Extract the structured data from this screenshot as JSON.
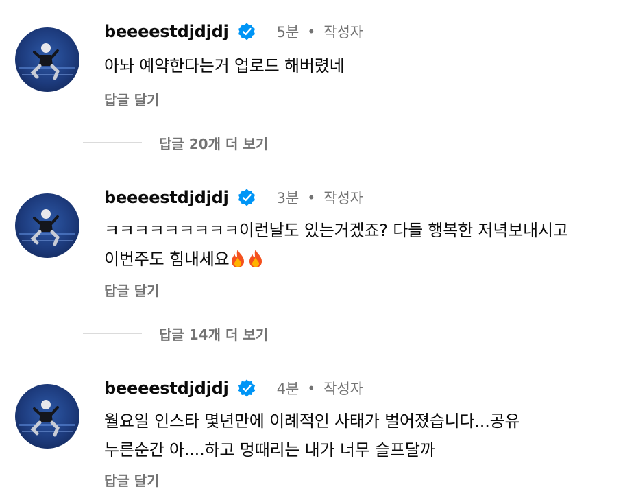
{
  "comments": [
    {
      "username": "beeeestdjdjdj",
      "time": "5분",
      "author_badge": "작성자",
      "lines": [
        "아놔 예약한다는거 업로드 해버렸네"
      ],
      "reply_label": "답글 달기",
      "view_replies": "답글 20개 더 보기"
    },
    {
      "username": "beeeestdjdjdj",
      "time": "3분",
      "author_badge": "작성자",
      "lines": [
        "ㅋㅋㅋㅋㅋㅋㅋㅋㅋ이런날도 있는거겠죠? 다들 행복한 저녁보내시고",
        "이번주도 힘내세요"
      ],
      "reply_label": "답글 달기",
      "view_replies": "답글 14개 더 보기"
    },
    {
      "username": "beeeestdjdjdj",
      "time": "4분",
      "author_badge": "작성자",
      "lines": [
        "월요일 인스타 몇년만에 이례적인 사태가 벌어졌습니다...공유",
        "누른순간 아....하고 멍때리는 내가 너무 슬프달까"
      ],
      "reply_label": "답글 달기"
    }
  ],
  "separator_dot": "•",
  "colors": {
    "verified": "#0095f6",
    "secondary_text": "#737373",
    "divider": "#dbdbdb"
  },
  "icons": [
    "avatar-photo",
    "verified-badge-icon",
    "fire-emoji-icon"
  ]
}
